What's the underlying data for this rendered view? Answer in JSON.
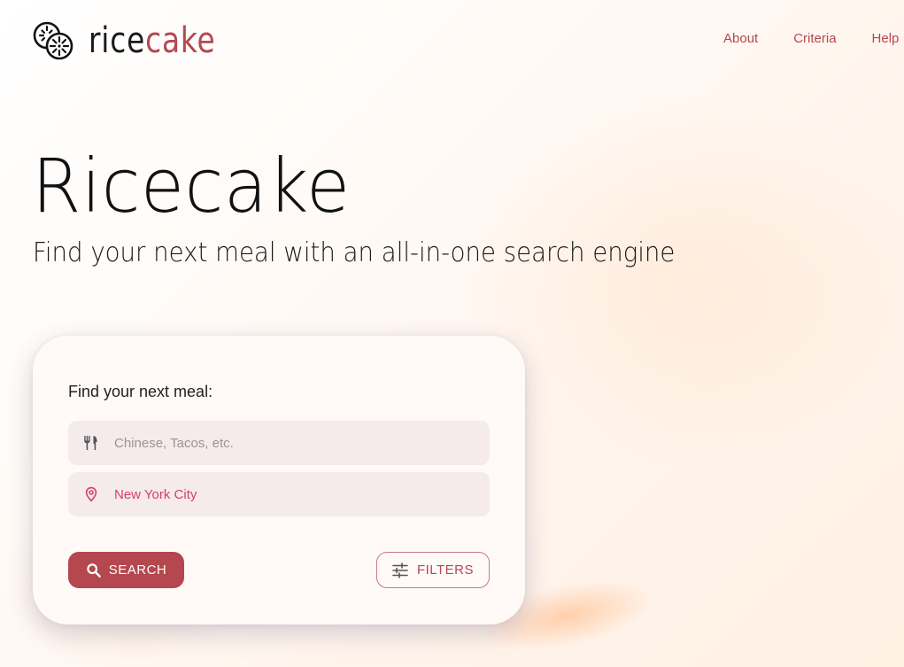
{
  "brand": {
    "name_part1": "rice",
    "name_part2": "cake",
    "logo_icon": "rice-cake-logo-icon",
    "colors": {
      "dark": "#1b1b1b",
      "accent": "#b5474f"
    }
  },
  "nav": {
    "items": [
      {
        "label": "About"
      },
      {
        "label": "Criteria"
      },
      {
        "label": "Help"
      }
    ]
  },
  "hero": {
    "title": "Ricecake",
    "subtitle": "Find your next meal with an all-in-one search engine"
  },
  "search_card": {
    "label": "Find your next meal:",
    "cuisine_field": {
      "placeholder": "Chinese, Tacos, etc.",
      "value": "",
      "icon": "utensils-icon"
    },
    "location_field": {
      "value": "New York City",
      "icon": "map-pin-icon"
    },
    "search_button": {
      "label": "SEARCH",
      "icon": "search-icon"
    },
    "filters_button": {
      "label": "FILTERS",
      "icon": "sliders-icon"
    }
  },
  "colors": {
    "accent": "#b5474f",
    "location_text": "#d4416a",
    "field_bg": "#f5eaec"
  }
}
